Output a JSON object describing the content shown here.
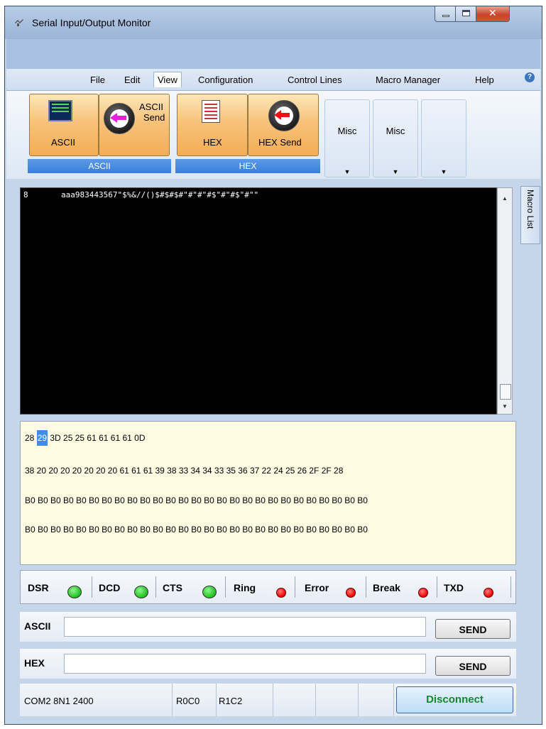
{
  "window": {
    "title": "Serial Input/Output Monitor"
  },
  "menu": {
    "items": [
      "File",
      "Edit",
      "View",
      "Configuration",
      "Control Lines",
      "Macro Manager",
      "Help"
    ],
    "help_glyph": "?"
  },
  "ribbon": {
    "ascii_group": {
      "label": "ASCII",
      "ascii_btn": "ASCII",
      "ascii_send_line1": "ASCII",
      "ascii_send_line2": "Send"
    },
    "hex_group": {
      "label": "HEX",
      "hex_btn": "HEX",
      "hex_send_btn": "HEX Send"
    },
    "misc1": "Misc",
    "misc2": "Misc",
    "dropdown_glyph": "▼"
  },
  "terminal": {
    "text": "8       aaa983443567\"$%&//()$#$#$#\"#\"#\"#$\"#\"#$\"#\"\""
  },
  "side_tab": {
    "label": "Macro List"
  },
  "hex_view": {
    "line1_pre": "28 ",
    "line1_sel": "29",
    "line1_post": " 3D 25 25 61 61 61 61 0D",
    "line2": "38 20 20 20 20 20 20 20 61 61 61 39 38 33 34 34 33 35 36 37 22 24 25 26 2F 2F 28",
    "line3": "B0 B0 B0 B0 B0 B0 B0 B0 B0 B0 B0 B0 B0 B0 B0 B0 B0 B0 B0 B0 B0 B0 B0 B0 B0 B0 B0",
    "line4": "B0 B0 B0 B0 B0 B0 B0 B0 B0 B0 B0 B0 B0 B0 B0 B0 B0 B0 B0 B0 B0 B0 B0 B0 B0 B0 B0"
  },
  "control_lines": [
    {
      "name": "DSR",
      "state": "green"
    },
    {
      "name": "DCD",
      "state": "green"
    },
    {
      "name": "CTS",
      "state": "green"
    },
    {
      "name": "Ring",
      "state": "red"
    },
    {
      "name": "Error",
      "state": "red"
    },
    {
      "name": "Break",
      "state": "red"
    },
    {
      "name": "TXD",
      "state": "red"
    }
  ],
  "ascii_row": {
    "label": "ASCII",
    "value": "",
    "send": "SEND"
  },
  "hex_row": {
    "label": "HEX",
    "value": "",
    "send": "SEND"
  },
  "status": {
    "port": "COM2 8N1 2400",
    "pos1": "R0C0",
    "pos2": "R1C2",
    "disconnect": "Disconnect"
  },
  "colors": {
    "led_green": "#1fbf1f",
    "led_red": "#e00000",
    "disconnect_text": "#15882e",
    "hex_bg": "#fdfce2",
    "group_label_bg": "#3a7fdc"
  }
}
